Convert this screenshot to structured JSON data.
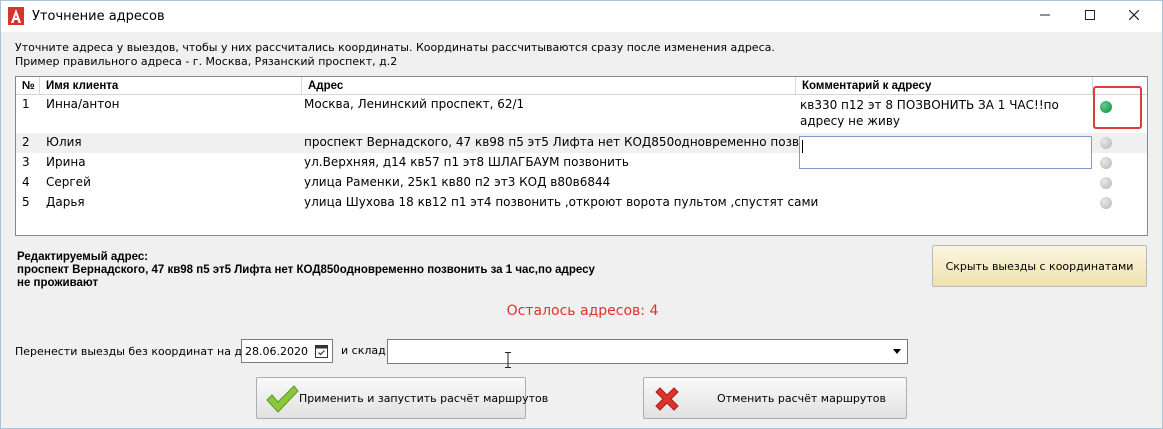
{
  "window": {
    "title": "Уточнение адресов",
    "accent": "#d9342b"
  },
  "hints": {
    "line1": "Уточните адреса у выездов, чтобы у них рассчитались координаты. Координаты рассчитываются сразу после изменения адреса.",
    "line2": "Пример правильного адреса - г. Москва, Рязанский проспект, д.2"
  },
  "grid": {
    "columns": [
      "№",
      "Имя клиента",
      "Адрес",
      "Комментарий к адресу"
    ],
    "rows": [
      {
        "num": "1",
        "client": "Инна/антон",
        "address": "Москва, Ленинский проспект, 62/1",
        "comment": "кв330 п12 эт 8 ПОЗВОНИТЬ ЗА 1 ЧАС!!по адресу не живу",
        "status": "green"
      },
      {
        "num": "2",
        "client": "Юлия",
        "address": "проспект Вернадского, 47 кв98 п5 эт5 Лифта нет КОД850одновременно позвонить",
        "comment": "",
        "status": "gray"
      },
      {
        "num": "3",
        "client": "Ирина",
        "address": "ул.Верхняя, д14 кв57 п1 эт8 ШЛАГБАУМ позвонить",
        "comment": "",
        "status": "gray"
      },
      {
        "num": "4",
        "client": "Сергей",
        "address": "улица Раменки, 25к1 кв80 п2 эт3 КОД в80в6844",
        "comment": "",
        "status": "gray"
      },
      {
        "num": "5",
        "client": "Дарья",
        "address": "улица Шухова 18 кв12 п1 эт4 позвонить ,откроют ворота пультом ,спустят сами",
        "comment": "",
        "status": "gray"
      }
    ]
  },
  "edited": {
    "label": "Редактируемый адрес:",
    "line1": "проспект Вернадского, 47 кв98 п5 эт5 Лифта нет КОД850одновременно позвонить за 1 час,по адресу",
    "line2": "не проживают"
  },
  "buttons": {
    "hide_with_coords": "Скрыть выезды с координатами",
    "apply": "Применить и запустить расчёт маршрутов",
    "cancel": "Отменить расчёт маршрутов"
  },
  "remaining": "Осталось адресов: 4",
  "transfer": {
    "label": "Перенести выезды без координат на дату",
    "date": "28.06.2020",
    "warehouse_label": "и склад",
    "warehouse_value": ""
  }
}
